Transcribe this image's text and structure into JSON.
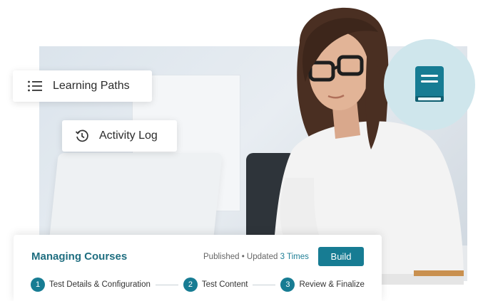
{
  "cards": {
    "learning_paths": "Learning Paths",
    "activity_log": "Activity Log"
  },
  "panel": {
    "title": "Managing Courses",
    "status_prefix": "Published • Updated",
    "status_link": "3 Times",
    "build_label": "Build",
    "steps": [
      {
        "num": "1",
        "label": "Test Details & Configuration"
      },
      {
        "num": "2",
        "label": "Test Content"
      },
      {
        "num": "3",
        "label": "Review & Finalize"
      }
    ]
  },
  "icons": {
    "list": "list-icon",
    "history": "history-icon",
    "book": "book-icon"
  },
  "colors": {
    "accent": "#177c93",
    "title": "#1f6e80",
    "circle": "#cfe6ec"
  }
}
